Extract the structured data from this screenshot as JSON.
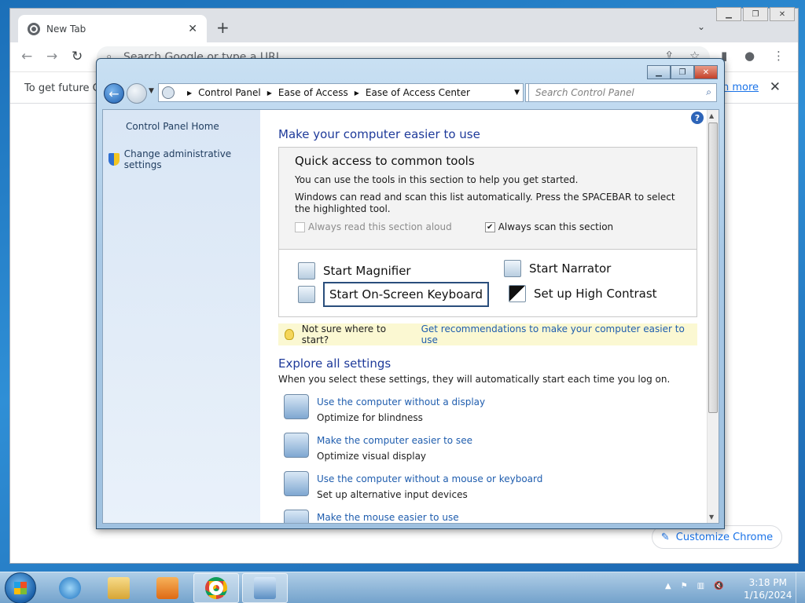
{
  "chrome": {
    "tab_title": "New Tab",
    "omnibox_placeholder": "Search Google or type a URL",
    "infobar_text": "To get future Go",
    "infobar_link": "n more",
    "customize_label": "Customize Chrome"
  },
  "cp": {
    "address": [
      "Control Panel",
      "Ease of Access",
      "Ease of Access Center"
    ],
    "search_placeholder": "Search Control Panel",
    "left": {
      "home": "Control Panel Home",
      "admin": "Change administrative settings"
    },
    "heading": "Make your computer easier to use",
    "quick": {
      "title": "Quick access to common tools",
      "line1": "You can use the tools in this section to help you get started.",
      "line2": "Windows can read and scan this list automatically.  Press the SPACEBAR to select the highlighted tool.",
      "read_aloud": "Always read this section aloud",
      "read_aloud_checked": false,
      "scan": "Always scan this section",
      "scan_checked": true
    },
    "tools": {
      "magnifier": "Start Magnifier",
      "narrator": "Start Narrator",
      "keyboard": "Start On-Screen Keyboard",
      "contrast": "Set up High Contrast"
    },
    "tip": {
      "prefix": "Not sure where to start?",
      "link": "Get recommendations to make your computer easier to use"
    },
    "explore": {
      "title": "Explore all settings",
      "desc": "When you select these settings, they will automatically start each time you log on.",
      "items": [
        {
          "link": "Use the computer without a display",
          "desc": "Optimize for blindness"
        },
        {
          "link": "Make the computer easier to see",
          "desc": "Optimize visual display"
        },
        {
          "link": "Use the computer without a mouse or keyboard",
          "desc": "Set up alternative input devices"
        },
        {
          "link": "Make the mouse easier to use",
          "desc": ""
        }
      ]
    }
  },
  "taskbar": {
    "time": "3:18 PM",
    "date": "1/16/2024"
  }
}
